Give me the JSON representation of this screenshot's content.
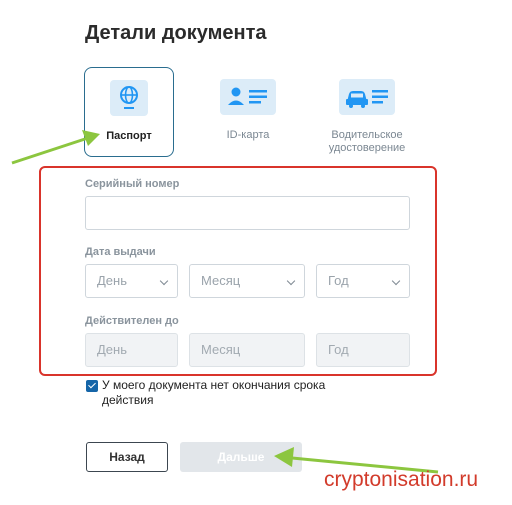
{
  "page": {
    "title": "Детали документа"
  },
  "doc_types": [
    {
      "label": "Паспорт",
      "icon": "globe-icon",
      "selected": true
    },
    {
      "label": "ID-карта",
      "icon": "id-card-icon",
      "selected": false
    },
    {
      "label": "Водительское удостоверение",
      "icon": "car-icon",
      "selected": false
    }
  ],
  "serial": {
    "label": "Серийный номер",
    "value": ""
  },
  "issue_date": {
    "label": "Дата выдачи",
    "day": "День",
    "month": "Месяц",
    "year": "Год"
  },
  "valid_until": {
    "label": "Действителен до",
    "day": "День",
    "month": "Месяц",
    "year": "Год"
  },
  "no_expiry": {
    "label": "У моего документа нет окончания срока действия",
    "checked": true
  },
  "buttons": {
    "back": "Назад",
    "next": "Дальше"
  },
  "watermark": "cryptonisation.ru",
  "colors": {
    "accent": "#2a6d8f",
    "icon_fill": "#2196f3",
    "icon_bg": "#dcecf8",
    "highlight_box": "#d9342b",
    "arrow": "#8cc63f",
    "checkbox": "#1565a8"
  }
}
